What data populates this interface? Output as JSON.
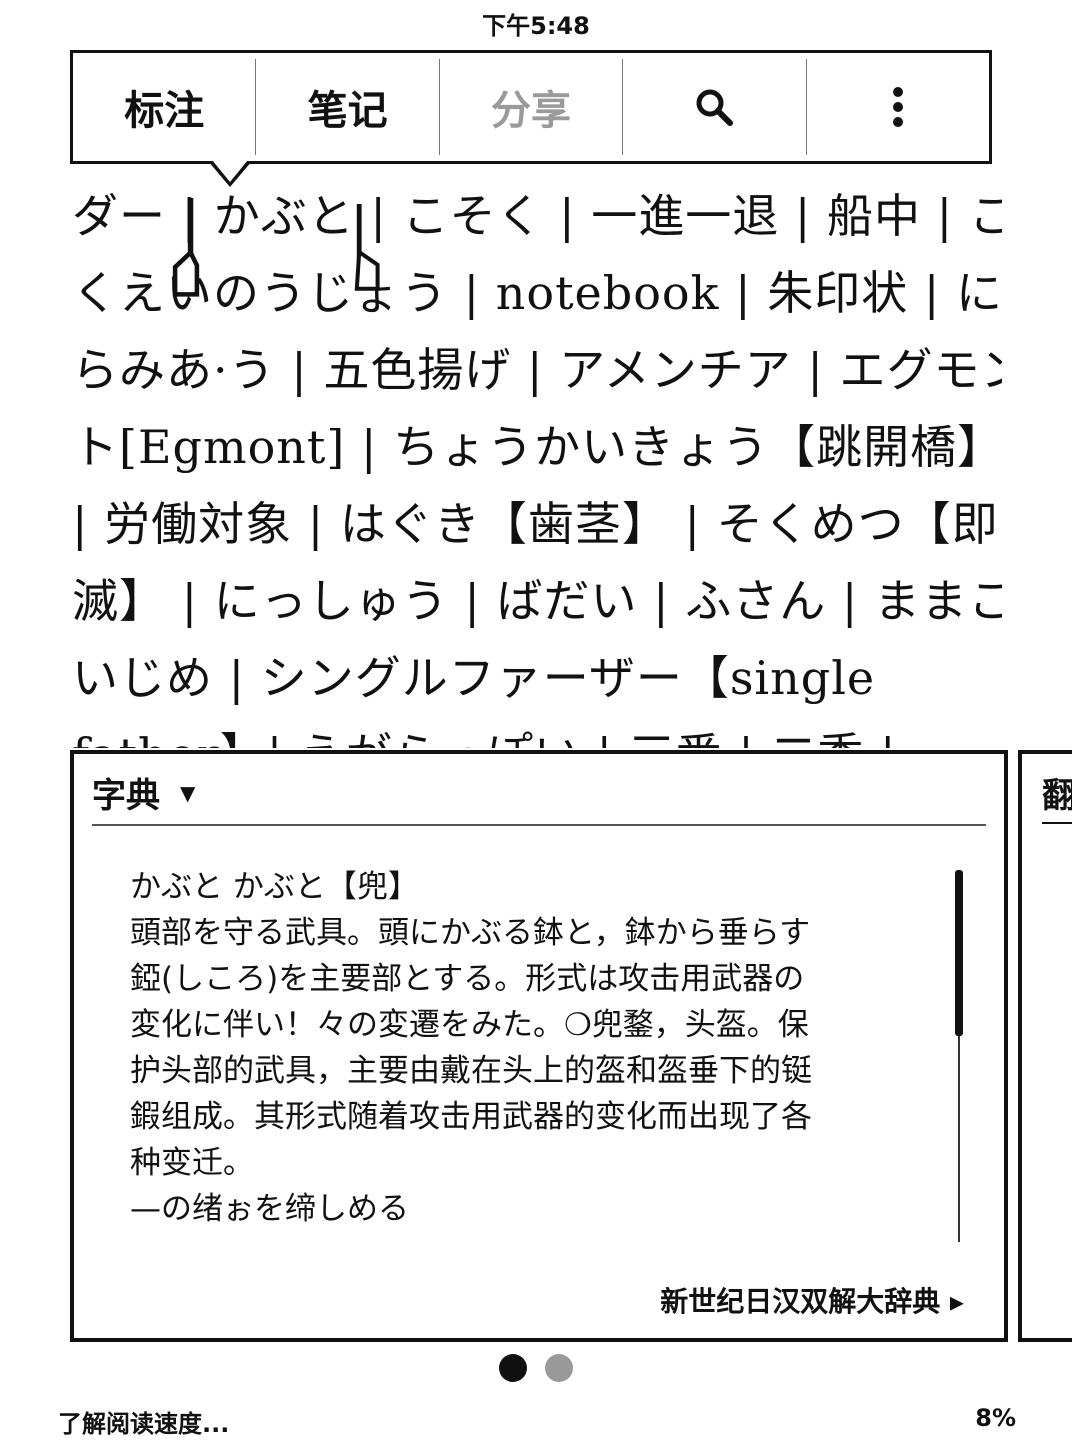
{
  "status": {
    "time": "下午5:48"
  },
  "toolbar": {
    "highlight": "标注",
    "note": "笔记",
    "share": "分享",
    "search_icon": "search-icon",
    "more_icon": "more-vertical-icon"
  },
  "book": {
    "lines": [
      "ダー | かぶと | こそく | 一進一退 | 船中 | こ",
      "くえいのうじょう | notebook | 朱印状 | に",
      "らみあ·う | 五色揚げ | アメンチア | エグモン",
      "ト[Egmont] | ちょうかいきょう【跳開橋】",
      "| 労働対象 | はぐき【歯茎】 | そくめつ【即",
      "滅】 | にっしゅう | ばだい | ふさん | ままこ",
      "いじめ | シングルファーザー【single",
      "father】| えがらっぽい | 三番 | 二季 |"
    ]
  },
  "dictionary": {
    "title": "字典",
    "lines": [
      "かぶと かぶと【兜】",
      "頭部を守る武具。頭にかぶる鉢と，鉢から垂らす",
      "錏(しころ)を主要部とする。形式は攻击用武器の",
      "変化に伴い！々の変遷をみた。❍兜鍪，头盔。保",
      "护头部的武具，主要由戴在头上的盔和盔垂下的铤",
      "鍜组成。其形式随着攻击用武器的变化而出现了各",
      "种变迁。",
      "—の绪ぉを缔しめる"
    ],
    "source": "新世纪日汉双解大辞典 ▸"
  },
  "next_panel": {
    "title": "翻"
  },
  "pagination": {
    "current": 1,
    "total": 2
  },
  "footer": {
    "left": "了解阅读速度...",
    "right": "8%"
  }
}
